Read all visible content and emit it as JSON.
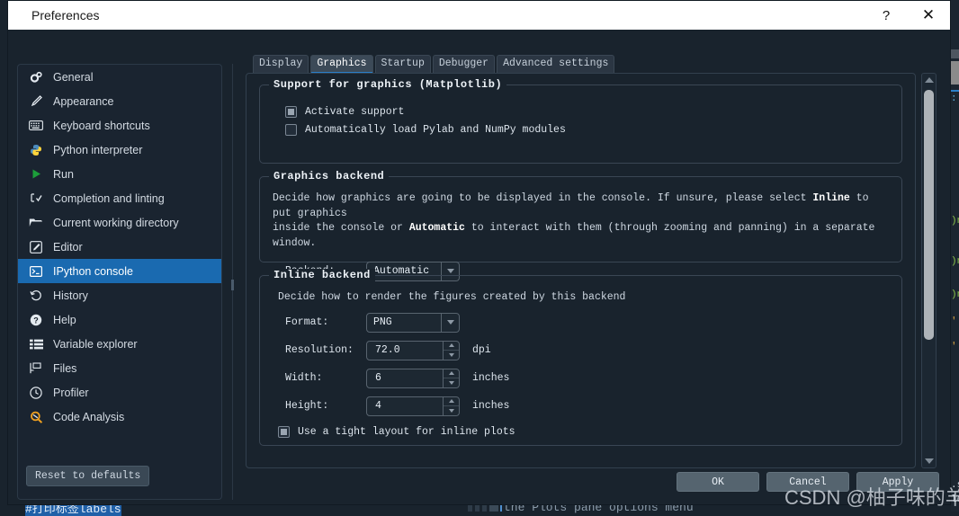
{
  "window": {
    "title": "Preferences",
    "help_button": "?",
    "close_button": "✕"
  },
  "sidebar": {
    "items": [
      {
        "label": "General",
        "icon": "gears-icon"
      },
      {
        "label": "Appearance",
        "icon": "paintbrush-icon"
      },
      {
        "label": "Keyboard shortcuts",
        "icon": "keyboard-icon"
      },
      {
        "label": "Python interpreter",
        "icon": "python-icon"
      },
      {
        "label": "Run",
        "icon": "play-icon"
      },
      {
        "label": "Completion and linting",
        "icon": "completion-icon"
      },
      {
        "label": "Current working directory",
        "icon": "folder-icon"
      },
      {
        "label": "Editor",
        "icon": "edit-icon"
      },
      {
        "label": "IPython console",
        "icon": "console-icon"
      },
      {
        "label": "History",
        "icon": "history-icon"
      },
      {
        "label": "Help",
        "icon": "question-circle-icon"
      },
      {
        "label": "Variable explorer",
        "icon": "table-icon"
      },
      {
        "label": "Files",
        "icon": "files-icon"
      },
      {
        "label": "Profiler",
        "icon": "clock-icon"
      },
      {
        "label": "Code Analysis",
        "icon": "magnifier-icon"
      }
    ],
    "active_index": 8,
    "reset_button": "Reset to defaults"
  },
  "tabs": [
    {
      "label": "Display"
    },
    {
      "label": "Graphics"
    },
    {
      "label": "Startup"
    },
    {
      "label": "Debugger"
    },
    {
      "label": "Advanced settings"
    }
  ],
  "active_tab_index": 1,
  "groups": {
    "support": {
      "title": "Support for graphics (Matplotlib)",
      "checkboxes": [
        {
          "label": "Activate support",
          "checked": true
        },
        {
          "label": "Automatically load Pylab and NumPy modules",
          "checked": false
        }
      ]
    },
    "backend": {
      "title": "Graphics backend",
      "desc_line1_a": "Decide how graphics are going to be displayed in the console. If unsure, please select ",
      "desc_line1_b": "Inline",
      "desc_line1_c": " to put graphics",
      "desc_line2_a": "inside the console or ",
      "desc_line2_b": "Automatic",
      "desc_line2_c": " to interact with them (through zooming and panning) in a separate window.",
      "field_label": "Backend:",
      "field_value": "Automatic"
    },
    "inline": {
      "title": "Inline backend",
      "desc": "Decide how to render the figures created by this backend",
      "fields": [
        {
          "label": "Format:",
          "value": "PNG",
          "unit": "",
          "kind": "combo"
        },
        {
          "label": "Resolution:",
          "value": "72.0",
          "unit": "dpi",
          "kind": "spin"
        },
        {
          "label": "Width:",
          "value": "6",
          "unit": "inches",
          "kind": "spin"
        },
        {
          "label": "Height:",
          "value": "4",
          "unit": "inches",
          "kind": "spin"
        }
      ],
      "checkbox": {
        "label": "Use a tight layout for inline plots",
        "checked": true
      }
    }
  },
  "footer": {
    "ok": "OK",
    "cancel": "Cancel",
    "apply": "Apply"
  },
  "background": {
    "editor_line": "#打印标签labels",
    "bottom_text": "the Plots pane options menu"
  },
  "watermark": "CSDN @柚子味的羊",
  "colors": {
    "window_bg": "#19232d",
    "titlebar_bg": "#ffffff",
    "accent": "#1a6ab0",
    "tab_accent": "#2a7fc9",
    "text": "#d4dbe3"
  }
}
